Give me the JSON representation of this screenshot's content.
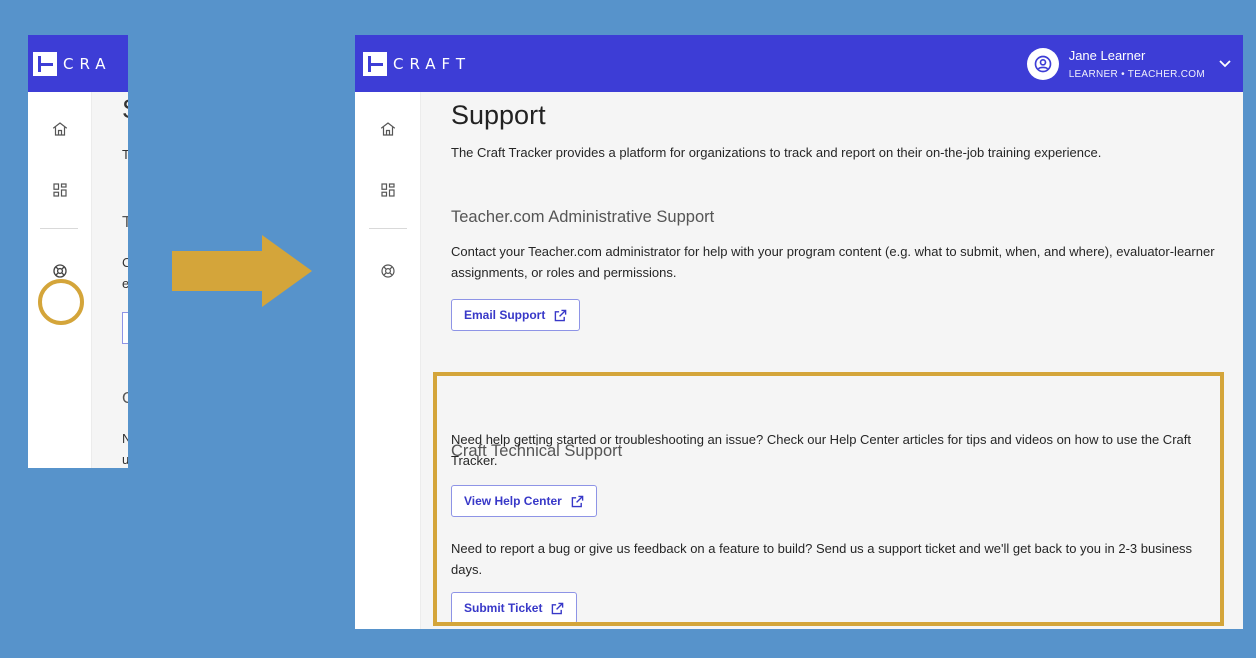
{
  "app": {
    "logo_text": "CRAFT",
    "mini_logo_text": "CRA",
    "brand_color": "#3d3dd6",
    "highlight_color": "#d4a53a",
    "background_color": "#5793cb"
  },
  "user": {
    "name": "Jane Learner",
    "org": "LEARNER • TEACHER.COM",
    "avatar_icon": "account-circle-icon",
    "menu_icon": "chevron-down-icon"
  },
  "sidebar": {
    "items": [
      {
        "icon": "home-icon"
      },
      {
        "icon": "dashboard-grid-icon"
      },
      {
        "icon": "support-lifebuoy-icon"
      }
    ]
  },
  "page": {
    "title": "Support",
    "description": "The Craft Tracker provides a platform for organizations to track and report on their on-the-job training experience."
  },
  "admin_support": {
    "title": "Teacher.com Administrative Support",
    "text": "Contact your Teacher.com administrator for help with your program content (e.g. what to submit, when, and where), evaluator-learner assignments, or roles and permissions.",
    "button_label": "Email Support"
  },
  "tech_support": {
    "title": "Craft Technical Support",
    "help_text": "Need help getting started or troubleshooting an issue? Check our Help Center articles for tips and videos on how to use the Craft Tracker.",
    "help_button_label": "View Help Center",
    "ticket_text": "Need to report a bug or give us feedback on a feature to build? Send us a support ticket and we'll get back to you in 2-3 business days.",
    "ticket_button_label": "Submit Ticket"
  },
  "mini_preview": {
    "fragments": [
      "S",
      "T",
      "T",
      "C",
      "e",
      "C",
      "N",
      "u"
    ]
  }
}
